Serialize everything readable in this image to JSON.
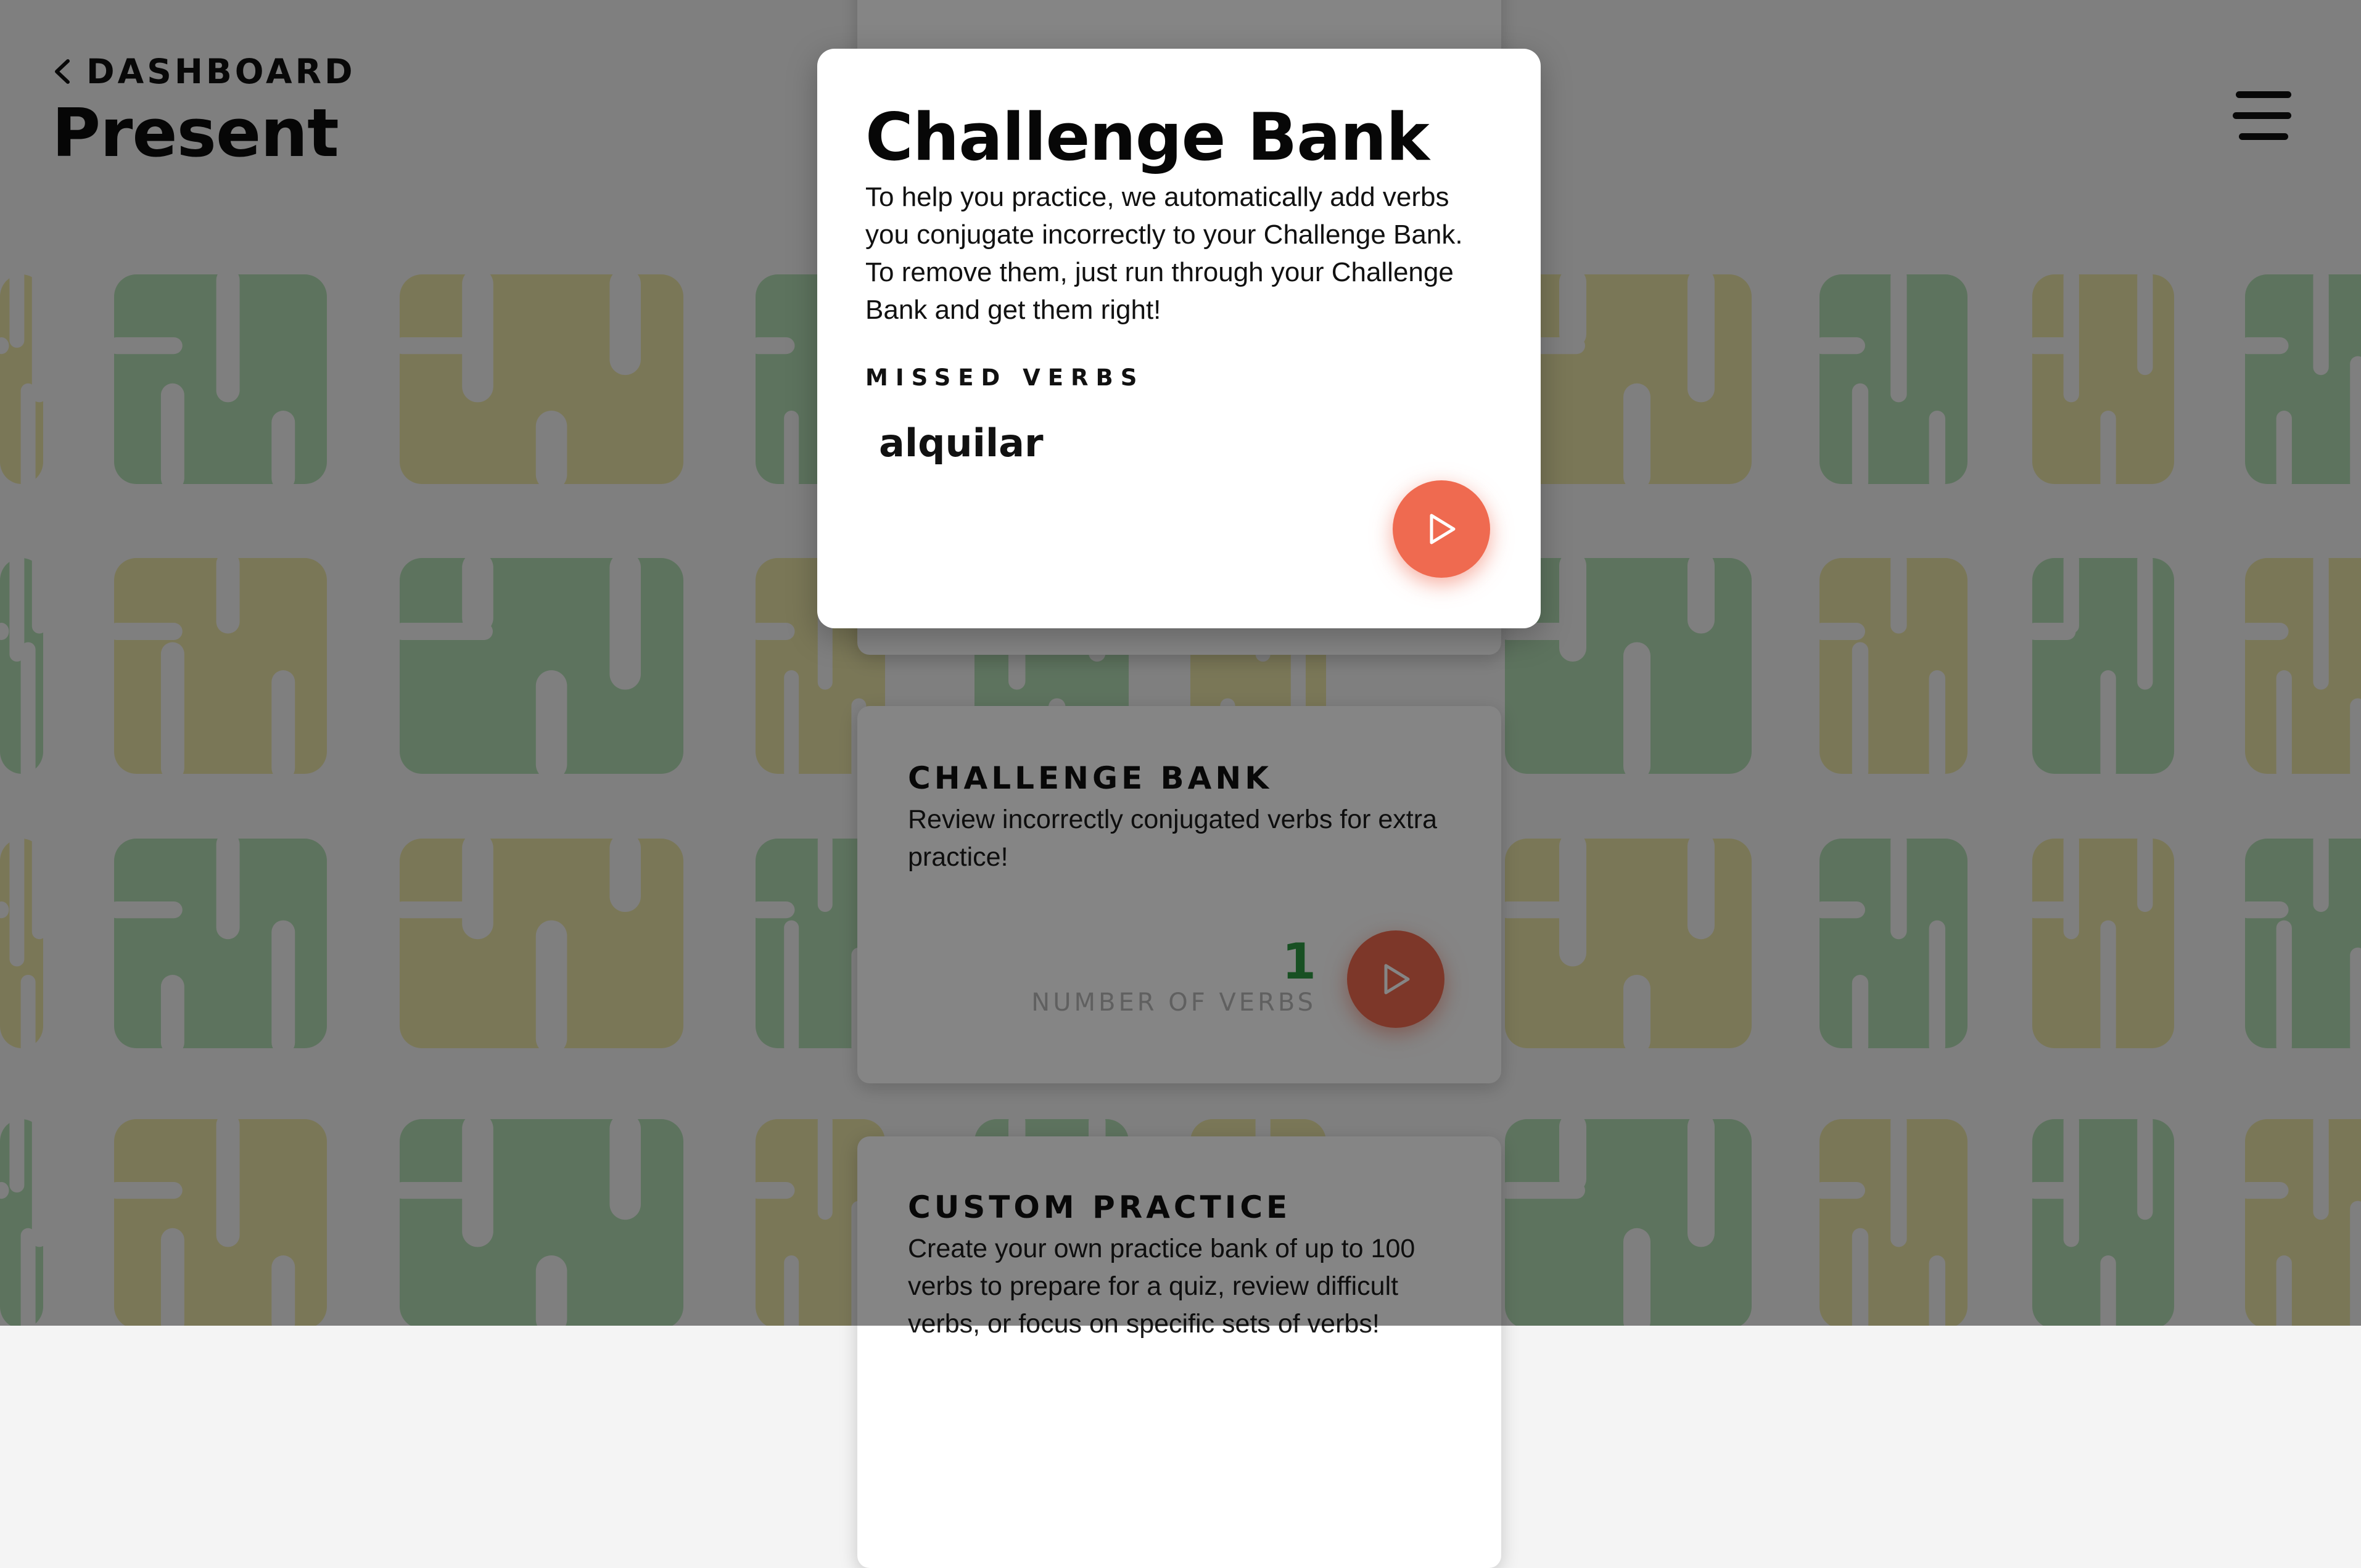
{
  "header": {
    "back_label": "DASHBOARD",
    "back_icon": "chevron-left-icon",
    "page_title": "Present",
    "menu_icon": "hamburger-menu-icon"
  },
  "cards": {
    "challenge_bank": {
      "heading": "CHALLENGE BANK",
      "description": "Review incorrectly conjugated verbs for extra practice!",
      "count_value": "1",
      "count_label": "NUMBER OF VERBS",
      "action_icon": "play-icon"
    },
    "custom_practice": {
      "heading": "CUSTOM PRACTICE",
      "description": "Create your own practice bank of up to 100 verbs to prepare for a quiz, review difficult verbs, or focus on specific sets of verbs!"
    }
  },
  "modal": {
    "title": "Challenge Bank",
    "description": "To help you practice, we automatically add verbs you conjugate incorrectly to your Challenge Bank. To remove them, just run through your Challenge Bank and get them right!",
    "missed_heading": "MISSED VERBS",
    "missed_verbs": [
      "alquilar"
    ],
    "action_icon": "play-icon"
  },
  "colors": {
    "accent": "#ef6a50",
    "count_green": "#2f9a43",
    "pattern_yellow": "#e7e19a",
    "pattern_green": "#a7d7a9"
  }
}
